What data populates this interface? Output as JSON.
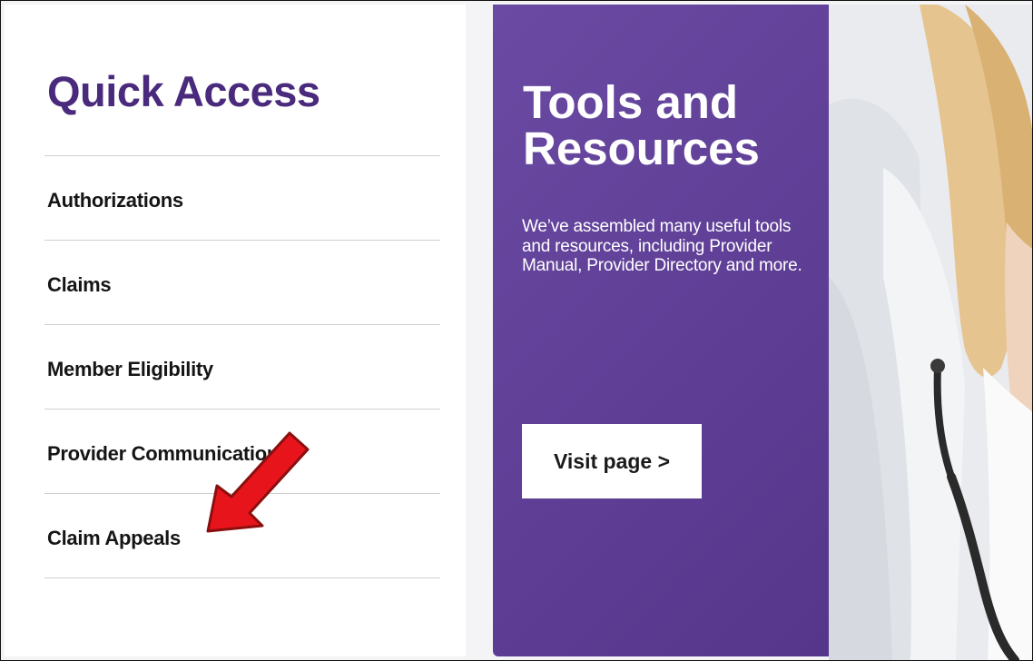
{
  "quick_access": {
    "title": "Quick Access",
    "items": [
      {
        "label": "Authorizations"
      },
      {
        "label": "Claims"
      },
      {
        "label": "Member Eligibility"
      },
      {
        "label": "Provider Communications"
      },
      {
        "label": "Claim Appeals"
      }
    ]
  },
  "promo": {
    "title": "Tools and Resources",
    "description": "We’ve assembled many useful tools and resources, including Provider Manual, Provider Directory and more.",
    "button_label": "Visit page >"
  },
  "colors": {
    "brand_purple": "#4a2a7c",
    "panel_purple": "#64449c",
    "annotation_red": "#e8141c"
  },
  "icons": {
    "annotation": "red-arrow-icon"
  }
}
